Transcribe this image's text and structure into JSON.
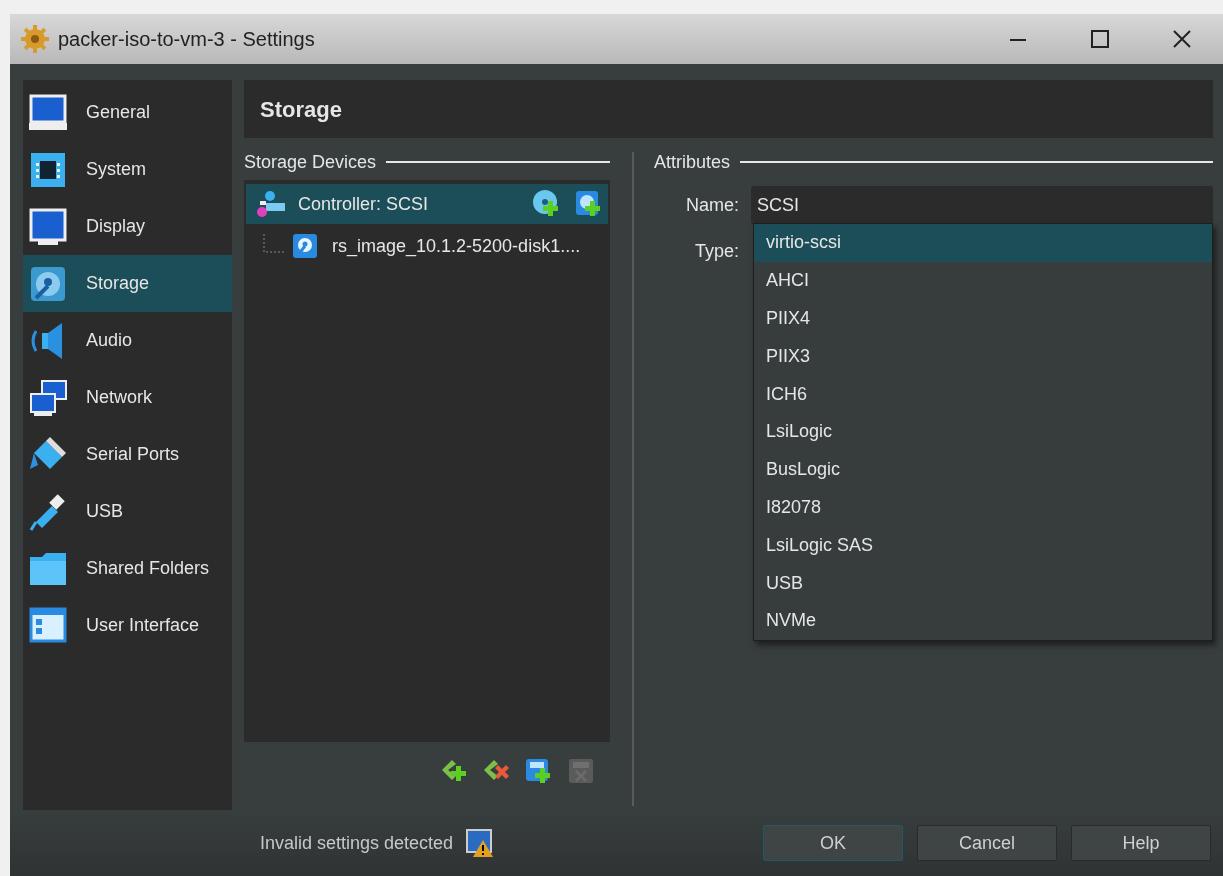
{
  "window": {
    "title": "packer-iso-to-vm-3 - Settings"
  },
  "sidebar": {
    "items": [
      {
        "label": "General",
        "selected": false
      },
      {
        "label": "System",
        "selected": false
      },
      {
        "label": "Display",
        "selected": false
      },
      {
        "label": "Storage",
        "selected": true
      },
      {
        "label": "Audio",
        "selected": false
      },
      {
        "label": "Network",
        "selected": false
      },
      {
        "label": "Serial Ports",
        "selected": false
      },
      {
        "label": "USB",
        "selected": false
      },
      {
        "label": "Shared Folders",
        "selected": false
      },
      {
        "label": "User Interface",
        "selected": false
      }
    ]
  },
  "page_title": "Storage",
  "storage_devices": {
    "heading": "Storage Devices",
    "tree": [
      {
        "label": "Controller: SCSI",
        "selected": true,
        "children": [
          {
            "label": "rs_image_10.1.2-5200-disk1....",
            "selected": false
          }
        ]
      }
    ]
  },
  "attributes": {
    "heading": "Attributes",
    "name_label": "Name:",
    "name_value": "SCSI",
    "type_label": "Type:",
    "type_options": [
      {
        "label": "virtio-scsi",
        "selected": true
      },
      {
        "label": "AHCI",
        "selected": false
      },
      {
        "label": "PIIX4",
        "selected": false
      },
      {
        "label": "PIIX3",
        "selected": false
      },
      {
        "label": "ICH6",
        "selected": false
      },
      {
        "label": "LsiLogic",
        "selected": false
      },
      {
        "label": "BusLogic",
        "selected": false
      },
      {
        "label": "I82078",
        "selected": false
      },
      {
        "label": "LsiLogic SAS",
        "selected": false
      },
      {
        "label": "USB",
        "selected": false
      },
      {
        "label": "NVMe",
        "selected": false
      }
    ]
  },
  "footer": {
    "status": "Invalid settings detected",
    "buttons": [
      {
        "label": "OK",
        "default": true
      },
      {
        "label": "Cancel",
        "default": false
      },
      {
        "label": "Help",
        "default": false
      }
    ]
  }
}
